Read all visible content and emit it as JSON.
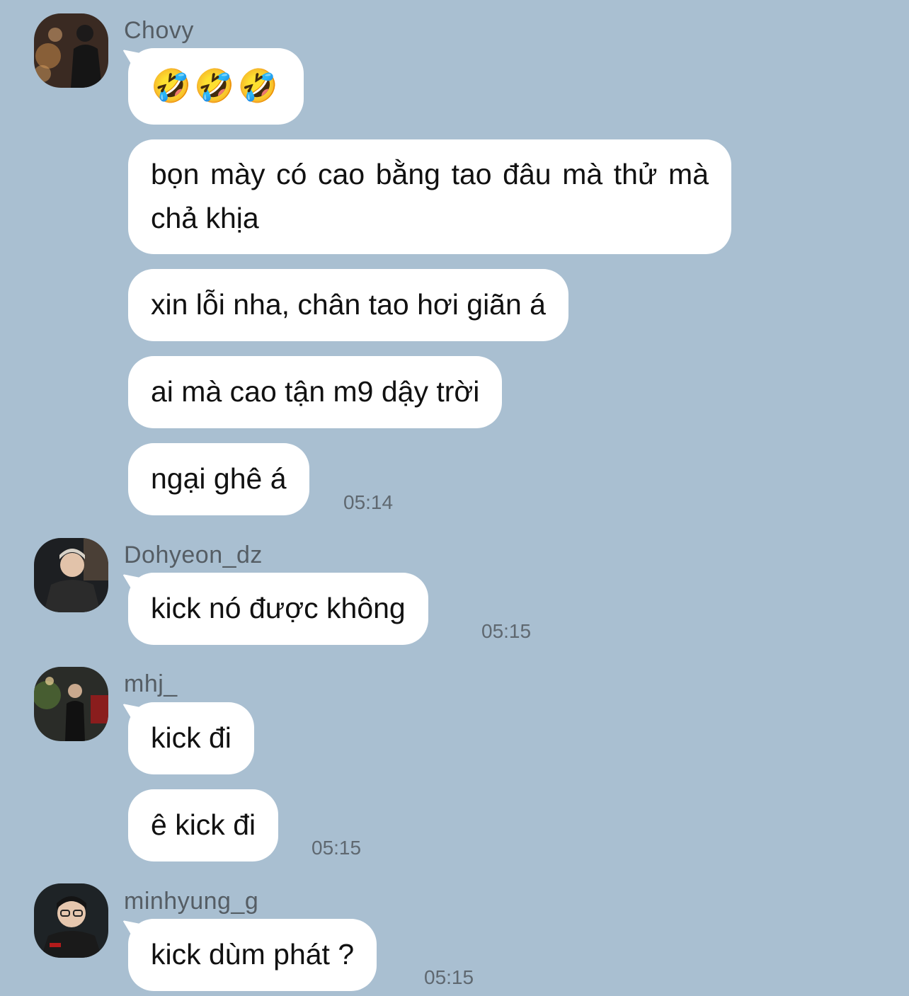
{
  "chat": {
    "groups": [
      {
        "sender": "Chovy",
        "avatar_icon": "avatar-photo-chovy",
        "messages": [
          "🤣🤣🤣",
          "bọn mày có cao bằng tao đâu mà thử mà chả khịa",
          "xin lỗi nha, chân tao hơi giãn á",
          "ai mà cao tận m9 dậy trời",
          "ngại ghê á"
        ],
        "time": "05:14"
      },
      {
        "sender": "Dohyeon_dz",
        "avatar_icon": "avatar-photo-dohyeon",
        "messages": [
          "kick nó được không"
        ],
        "time": "05:15"
      },
      {
        "sender": "mhj_",
        "avatar_icon": "avatar-photo-mhj",
        "messages": [
          "kick đi",
          "ê kick đi"
        ],
        "time": "05:15"
      },
      {
        "sender": "minhyung_g",
        "avatar_icon": "avatar-photo-minhyung",
        "messages": [
          "kick dùm phát ?"
        ],
        "time": "05:15"
      }
    ]
  },
  "colors": {
    "background": "#a9bfd1",
    "bubble": "#ffffff",
    "sender_text": "#555d64",
    "time_text": "#5f6870"
  }
}
